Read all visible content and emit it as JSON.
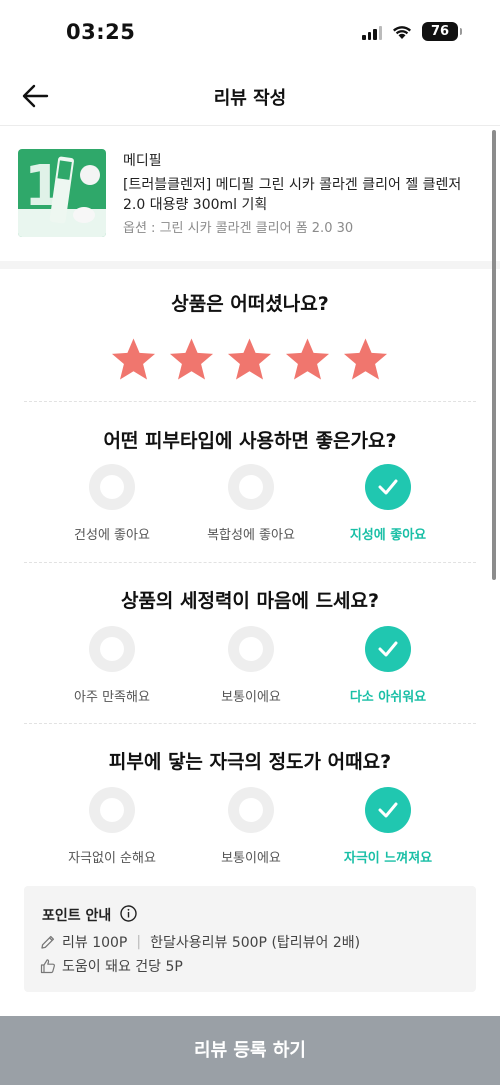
{
  "status": {
    "time": "03:25",
    "battery": "76"
  },
  "header": {
    "title": "리뷰 작성"
  },
  "product": {
    "brand": "메디필",
    "name": "[트러블클렌저] 메디필 그린 시카 콜라겐 클리어 젤 클렌저 2.0 대용량 300ml 기획",
    "option": "옵션 : 그린 시카 콜라겐 클리어 폼 2.0 30"
  },
  "rating": {
    "question": "상품은 어떠셨나요?",
    "value": 5,
    "max": 5,
    "star_color": "#f0766e"
  },
  "skin_type": {
    "question": "어떤 피부타입에 사용하면 좋은가요?",
    "options": [
      "건성에 좋아요",
      "복합성에 좋아요",
      "지성에 좋아요"
    ],
    "selected": 2
  },
  "cleansing": {
    "question": "상품의 세정력이 마음에 드세요?",
    "options": [
      "아주 만족해요",
      "보통이에요",
      "다소 아쉬워요"
    ],
    "selected": 2
  },
  "irritation": {
    "question": "피부에 닿는 자극의 정도가 어때요?",
    "options": [
      "자극없이 순해요",
      "보통이에요",
      "자극이 느껴져요"
    ],
    "selected": 2
  },
  "points": {
    "title": "포인트 안내",
    "line1_a": "리뷰 100P",
    "line1_b": "한달사용리뷰 500P (탑리뷰어 2배)",
    "line2": "도움이 돼요 건당 5P"
  },
  "submit": {
    "label": "리뷰 등록 하기"
  },
  "colors": {
    "accent": "#20c7b0",
    "submit_bg": "#9aa0a6"
  }
}
